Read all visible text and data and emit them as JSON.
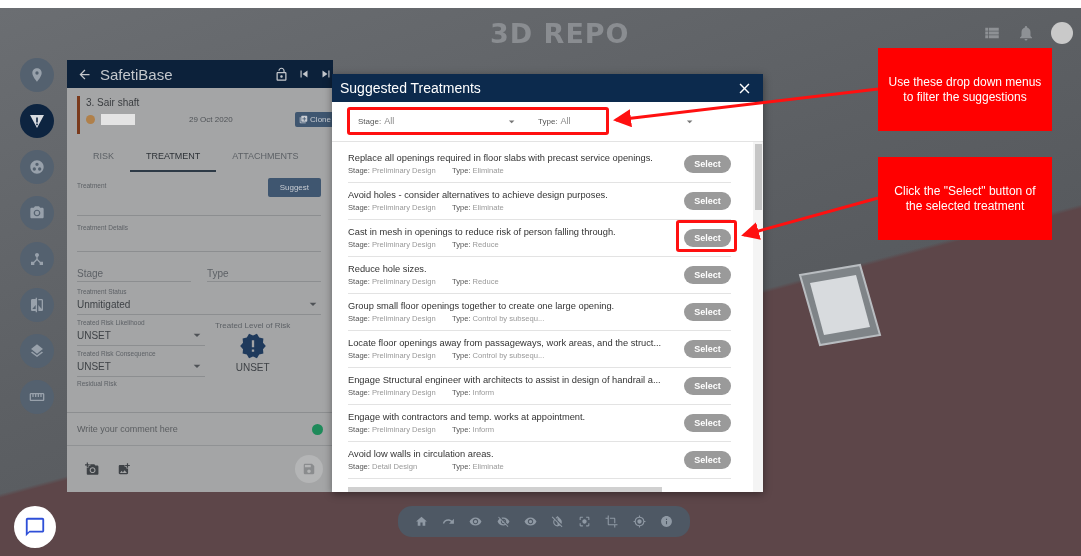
{
  "header": {
    "logo": "3D REPO"
  },
  "sidebar": {
    "items": [
      {
        "kind": "pin",
        "selected": false
      },
      {
        "kind": "risk",
        "selected": true
      },
      {
        "kind": "groups",
        "selected": false
      },
      {
        "kind": "camera",
        "selected": false
      },
      {
        "kind": "tree",
        "selected": false
      },
      {
        "kind": "compare",
        "selected": false
      },
      {
        "kind": "layers",
        "selected": false
      },
      {
        "kind": "ruler",
        "selected": false
      }
    ]
  },
  "panel": {
    "title": "SafetiBase",
    "risk_name": "3. Sair shaft",
    "risk_date": "29 Oct 2020",
    "clone": "Clone",
    "tabs": [
      {
        "label": "RISK",
        "selected": false
      },
      {
        "label": "TREATMENT",
        "selected": true
      },
      {
        "label": "ATTACHMENTS",
        "selected": false
      }
    ],
    "treatment_label": "Treatment",
    "suggest": "Suggest",
    "details_label": "Treatment Details",
    "stage_placeholder": "Stage",
    "type_placeholder": "Type",
    "status_label": "Treatment Status",
    "status_value": "Unmitigated",
    "likelihood_label": "Treated Risk Likelihood",
    "likelihood_value": "UNSET",
    "consequence_label": "Treated Risk Consequence",
    "consequence_value": "UNSET",
    "level_label": "Treated Level of Risk",
    "level_value": "UNSET",
    "residual_label": "Residual Risk",
    "comment_placeholder": "Write your comment here"
  },
  "modal": {
    "title": "Suggested Treatments",
    "filters": [
      {
        "label": "Stage:",
        "value": "All"
      },
      {
        "label": "Type:",
        "value": "All"
      }
    ],
    "select_labels": [
      "Select",
      "Select",
      "Select",
      "Select",
      "Select",
      "Select",
      "Select",
      "Select",
      "Select"
    ],
    "items": [
      {
        "text": "Replace all openings required in floor slabs with precast service openings.",
        "stage_label": "Stage:",
        "stage": "Preliminary Design",
        "type_label": "Type:",
        "type": "Eliminate"
      },
      {
        "text": "Avoid holes - consider alternatives to achieve design purposes.",
        "stage_label": "Stage:",
        "stage": "Preliminary Design",
        "type_label": "Type:",
        "type": "Eliminate"
      },
      {
        "text": "Cast in mesh in openings to reduce risk of person falling through.",
        "stage_label": "Stage:",
        "stage": "Preliminary Design",
        "type_label": "Type:",
        "type": "Reduce"
      },
      {
        "text": "Reduce hole sizes.",
        "stage_label": "Stage:",
        "stage": "Preliminary Design",
        "type_label": "Type:",
        "type": "Reduce"
      },
      {
        "text": "Group small floor openings together to create one large opening.",
        "stage_label": "Stage:",
        "stage": "Preliminary Design",
        "type_label": "Type:",
        "type": "Control by subsequ..."
      },
      {
        "text": "Locate floor openings away from passageways, work areas, and the struct...",
        "stage_label": "Stage:",
        "stage": "Preliminary Design",
        "type_label": "Type:",
        "type": "Control by subsequ..."
      },
      {
        "text": "Engage Structural engineer with architects to assist in design of handrail a...",
        "stage_label": "Stage:",
        "stage": "Preliminary Design",
        "type_label": "Type:",
        "type": "Inform"
      },
      {
        "text": "Engage with contractors and temp. works at appointment.",
        "stage_label": "Stage:",
        "stage": "Preliminary Design",
        "type_label": "Type:",
        "type": "Inform"
      },
      {
        "text": "Avoid low walls in circulation areas.",
        "stage_label": "Stage:",
        "stage": "Detail Design",
        "type_label": "Type:",
        "type": "Eliminate"
      }
    ]
  },
  "annotations": [
    {
      "text": "Use these drop down menus to filter the suggestions"
    },
    {
      "text": "Click the \"Select\" button of the selected treatment"
    }
  ]
}
